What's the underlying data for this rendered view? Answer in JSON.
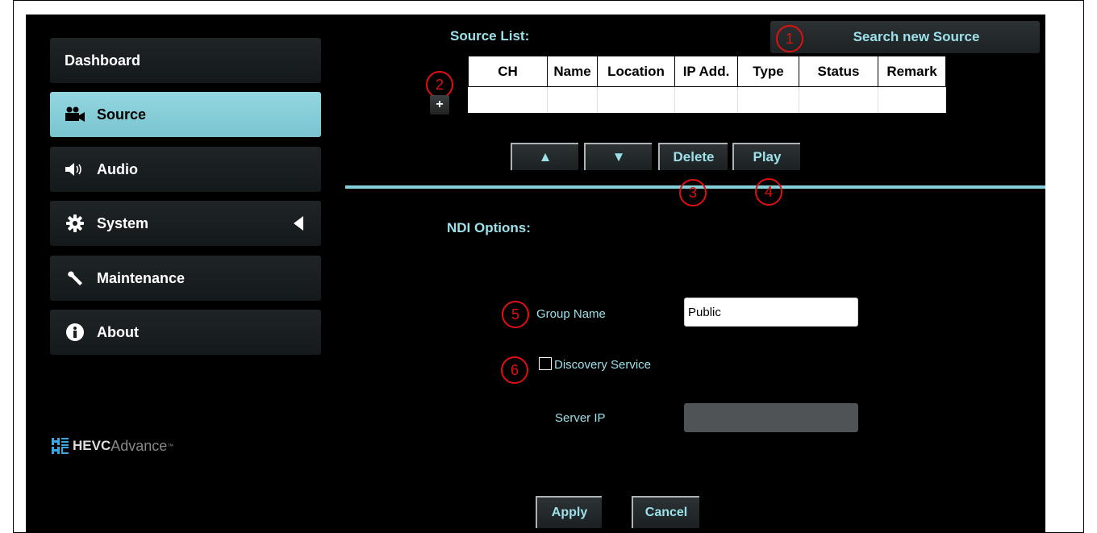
{
  "sidebar": {
    "items": [
      {
        "label": "Dashboard"
      },
      {
        "label": "Source"
      },
      {
        "label": "Audio"
      },
      {
        "label": "System"
      },
      {
        "label": "Maintenance"
      },
      {
        "label": "About"
      }
    ],
    "logo": {
      "strong": "HEVC",
      "thin": "Advance",
      "tm": "™"
    }
  },
  "source": {
    "title": "Source List:",
    "search_label": "Search new Source",
    "add_label": "+",
    "columns": [
      "CH",
      "Name",
      "Location",
      "IP Add.",
      "Type",
      "Status",
      "Remark"
    ],
    "buttons": {
      "up": "▲",
      "down": "▼",
      "delete": "Delete",
      "play": "Play"
    }
  },
  "ndi": {
    "title": "NDI Options:",
    "group_name_label": "Group Name",
    "group_name_value": "Public",
    "discovery_label": "Discovery Service",
    "discovery_checked": false,
    "server_ip_label": "Server IP",
    "server_ip_value": "",
    "apply_label": "Apply",
    "cancel_label": "Cancel"
  },
  "annotations": [
    "1",
    "2",
    "3",
    "4",
    "5",
    "6"
  ],
  "colors": {
    "accent": "#9ce0ea",
    "active_nav": "#86d0da",
    "badge": "#e01010"
  }
}
